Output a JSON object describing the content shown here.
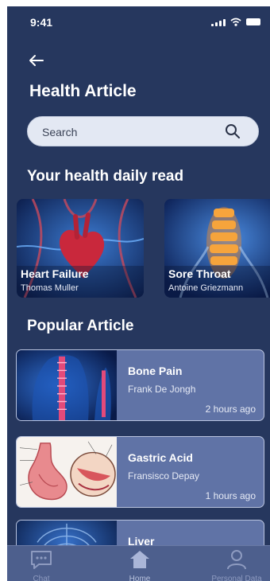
{
  "status": {
    "time": "9:41"
  },
  "header": {
    "title": "Health Article"
  },
  "search": {
    "placeholder": "Search"
  },
  "daily": {
    "heading": "Your health daily read",
    "cards": [
      {
        "title": "Heart Failure",
        "author": "Thomas Muller"
      },
      {
        "title": "Sore Throat",
        "author": "Antoine Griezmann"
      }
    ]
  },
  "popular": {
    "heading": "Popular Article",
    "items": [
      {
        "title": "Bone Pain",
        "author": "Frank De Jongh",
        "time": "2 hours ago"
      },
      {
        "title": "Gastric Acid",
        "author": "Fransisco Depay",
        "time": "1 hours ago"
      },
      {
        "title": "Liver",
        "author": "",
        "time": ""
      }
    ]
  },
  "tabs": [
    {
      "label": "Chat",
      "icon": "chat-icon"
    },
    {
      "label": "Home",
      "icon": "home-icon"
    },
    {
      "label": "Personal Data",
      "icon": "person-icon"
    }
  ],
  "colors": {
    "background": "#26375e",
    "card": "#6073a6",
    "search": "#e3e8f3"
  }
}
